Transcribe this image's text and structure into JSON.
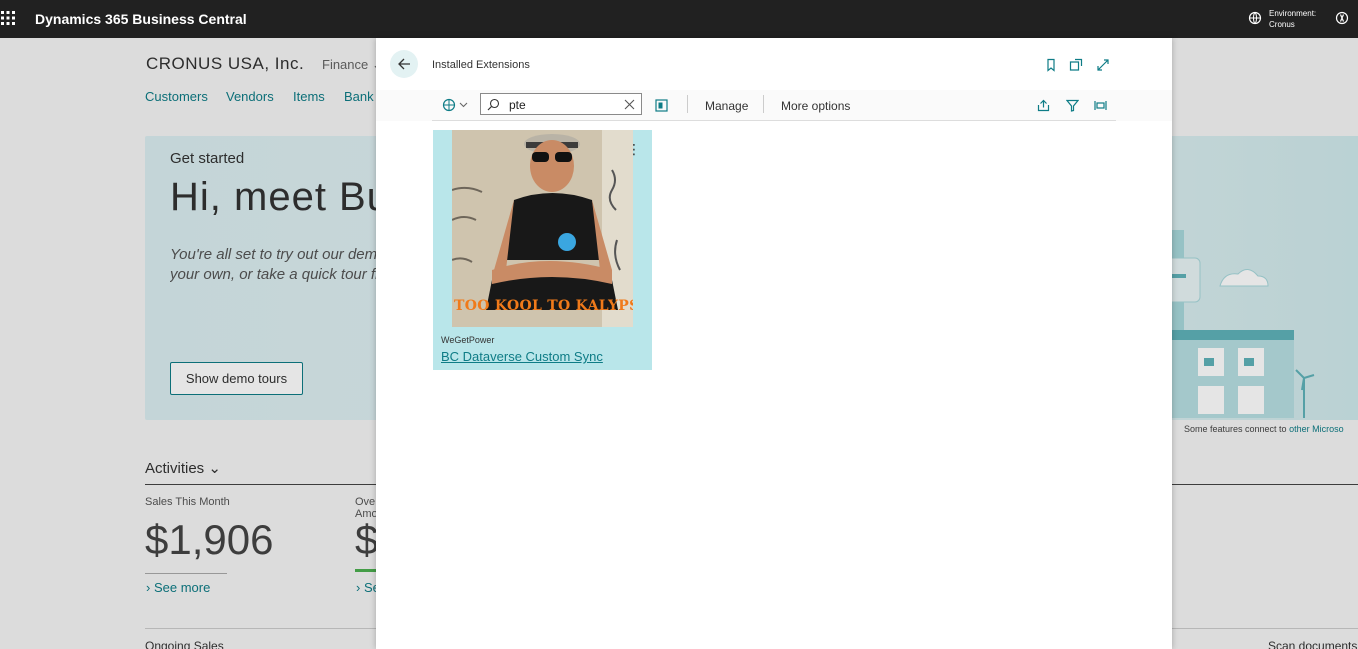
{
  "topbar": {
    "app_title": "Dynamics 365 Business Central",
    "env_label": "Environment:",
    "env_name": "Cronus",
    "bg": "#212121"
  },
  "background": {
    "company": "CRONUS USA, Inc.",
    "finance": "Finance",
    "nav": [
      "Customers",
      "Vendors",
      "Items",
      "Bank"
    ],
    "get_started": "Get started",
    "hi_meet": "Hi, meet Bus",
    "intro_line1": "You're all set to try out our demo",
    "intro_line2": "your own, or take a quick tour fi",
    "demo_button": "Show demo tours",
    "features_text": "Some features connect to",
    "features_link": "other Microso",
    "activities": "Activities",
    "sales_label": "Sales This Month",
    "sales_value": "$1,906",
    "see_more": "See more",
    "over_label1": "Ove",
    "over_label2": "Amo",
    "over_value": "$",
    "over_see": "Se",
    "ongoing": "Ongoing Sales",
    "scan_docs": "Scan documents"
  },
  "dialog": {
    "title": "Installed Extensions",
    "search_value": "pte",
    "manage": "Manage",
    "more_options": "More options",
    "accent": "#0e7c86"
  },
  "tile": {
    "image_caption": "TOO KOOL TO KALYPSO",
    "publisher": "WeGetPower",
    "name": "BC Dataverse Custom Sync",
    "bg": "#b9e6ea"
  }
}
